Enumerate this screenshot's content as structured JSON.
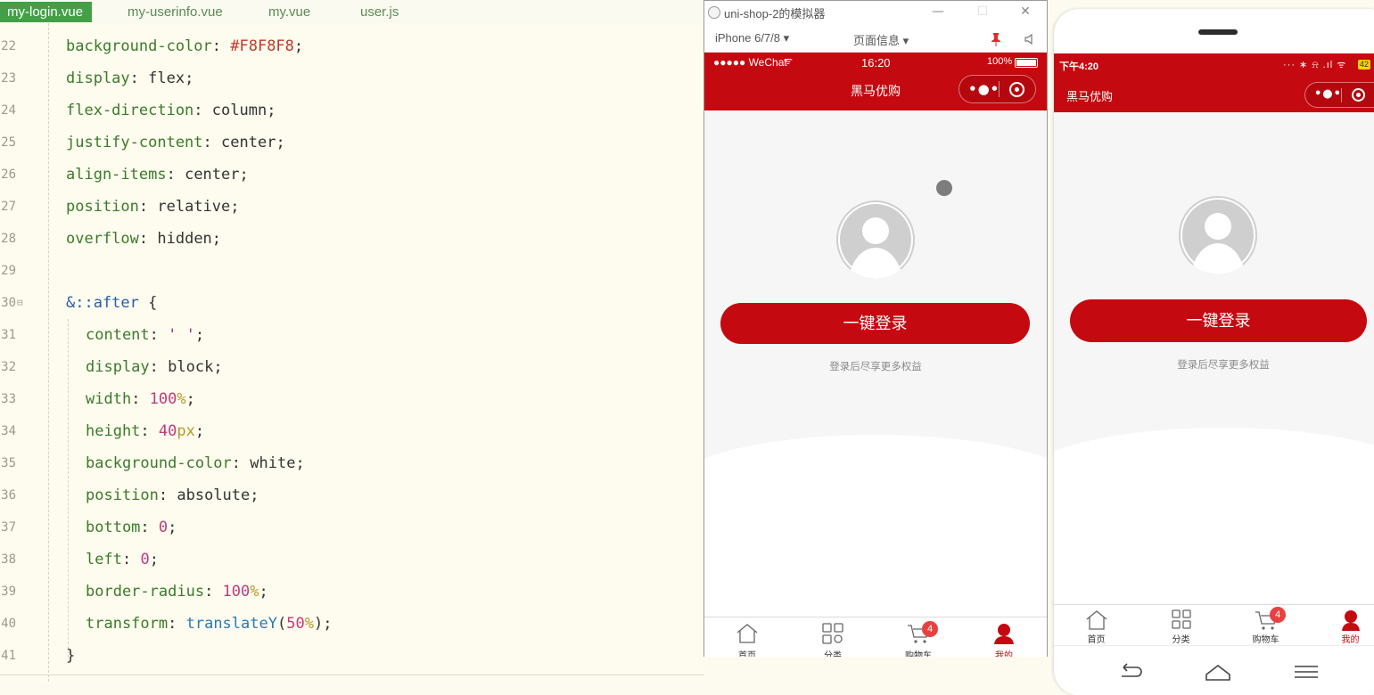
{
  "editor": {
    "tabs": [
      {
        "label": "my-login.vue",
        "active": true
      },
      {
        "label": "my-userinfo.vue",
        "active": false
      },
      {
        "label": "my.vue",
        "active": false
      },
      {
        "label": "user.js",
        "active": false
      }
    ],
    "lines": [
      {
        "n": "22",
        "prop": "background-color",
        "value": "#F8F8F8"
      },
      {
        "n": "23",
        "prop": "display",
        "value": "flex"
      },
      {
        "n": "24",
        "prop": "flex-direction",
        "value": "column"
      },
      {
        "n": "25",
        "prop": "justify-content",
        "value": "center"
      },
      {
        "n": "26",
        "prop": "align-items",
        "value": "center"
      },
      {
        "n": "27",
        "prop": "position",
        "value": "relative"
      },
      {
        "n": "28",
        "prop": "overflow",
        "value": "hidden"
      },
      {
        "n": "29"
      },
      {
        "n": "30",
        "selector": "&::after",
        "brace": "{"
      },
      {
        "n": "31",
        "prop": "content",
        "value": "' '"
      },
      {
        "n": "32",
        "prop": "display",
        "value": "block"
      },
      {
        "n": "33",
        "prop": "width",
        "num": "100",
        "unit": "%"
      },
      {
        "n": "34",
        "prop": "height",
        "num": "40",
        "unit": "px"
      },
      {
        "n": "35",
        "prop": "background-color",
        "value": "white"
      },
      {
        "n": "36",
        "prop": "position",
        "value": "absolute"
      },
      {
        "n": "37",
        "prop": "bottom",
        "num": "0",
        "unit": ""
      },
      {
        "n": "38",
        "prop": "left",
        "num": "0",
        "unit": ""
      },
      {
        "n": "39",
        "prop": "border-radius",
        "num": "100",
        "unit": "%"
      },
      {
        "n": "40",
        "prop": "transform",
        "fn": "translateY",
        "num": "50",
        "unit": "%"
      },
      {
        "n": "41",
        "brace": "}"
      }
    ]
  },
  "simulator": {
    "title": "uni-shop-2的模拟器",
    "device": "iPhone 6/7/8 ▾",
    "page_info": "页面信息 ▾",
    "status": {
      "carrier": "●●●●● WeChat",
      "time": "16:20",
      "battery": "100%"
    },
    "nav_title": "黑马优购",
    "login_button": "一键登录",
    "hint": "登录后尽享更多权益",
    "tabs": [
      {
        "label": "首页",
        "icon": "home-icon",
        "active": false
      },
      {
        "label": "分类",
        "icon": "category-icon",
        "active": false
      },
      {
        "label": "购物车",
        "icon": "cart-icon",
        "active": false,
        "badge": "4"
      },
      {
        "label": "我的",
        "icon": "user-icon",
        "active": true
      }
    ]
  },
  "phone": {
    "status": {
      "time": "下午4:20",
      "battery": "42"
    },
    "nav_title": "黑马优购",
    "login_button": "一键登录",
    "hint": "登录后尽享更多权益",
    "tabs": [
      {
        "label": "首页",
        "icon": "home-icon",
        "active": false
      },
      {
        "label": "分类",
        "icon": "category-icon",
        "active": false
      },
      {
        "label": "购物车",
        "icon": "cart-icon",
        "active": false,
        "badge": "4"
      },
      {
        "label": "我的",
        "icon": "user-icon",
        "active": true
      }
    ]
  },
  "colors": {
    "brand": "#c50910",
    "tab_active": "#43a047",
    "badge": "#e94040"
  }
}
